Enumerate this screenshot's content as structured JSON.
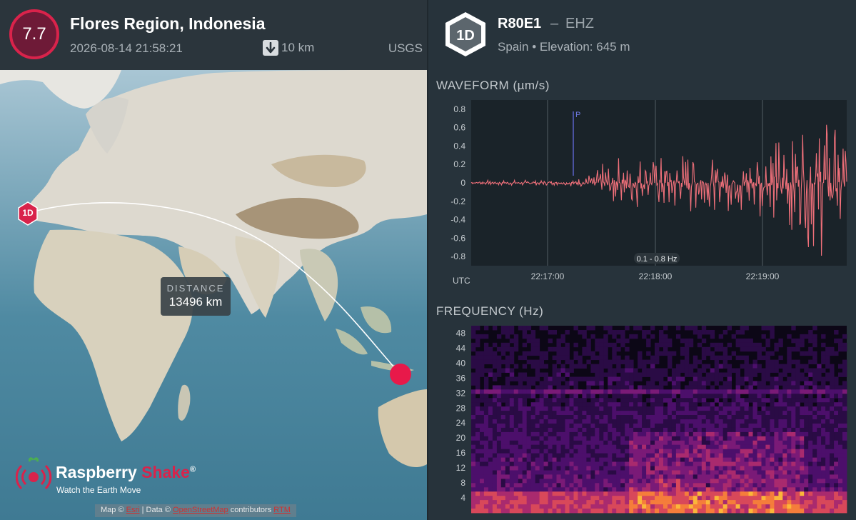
{
  "event": {
    "magnitude": "7.7",
    "title": "Flores Region, Indonesia",
    "datetime": "2026-08-14 21:58:21",
    "depth": "10 km",
    "source": "USGS"
  },
  "map": {
    "station_marker_label": "1D",
    "distance_label": "DISTANCE",
    "distance_value": "13496 km",
    "brand_name_part1": "Raspberry",
    "brand_name_part2": "Shake",
    "brand_registered": "®",
    "brand_tagline": "Watch the Earth Move",
    "attribution_prefix": "Map ©",
    "attribution_link1": "Esri",
    "attribution_mid": "| Data ©",
    "attribution_link2": "OpenStreetMap",
    "attribution_suffix": "contributors",
    "attribution_link3": "RTM",
    "colors": {
      "epicenter": "#e8194a",
      "station": "#d9234b",
      "path": "#ffffff"
    }
  },
  "station": {
    "badge": "1D",
    "code": "R80E1",
    "separator": "–",
    "channel": "EHZ",
    "location": "Spain • Elevation: 645 m"
  },
  "waveform": {
    "title": "WAVEFORM  (µm/s)",
    "y_ticks": [
      "0.8",
      "0.6",
      "0.4",
      "0.2",
      "0",
      "-0.2",
      "-0.4",
      "-0.6",
      "-0.8"
    ],
    "x_ticks": [
      "22:17:00",
      "22:18:00",
      "22:19:00"
    ],
    "x_axis_label": "UTC",
    "filter_label": "0.1 - 0.8 Hz",
    "phase_marker": "P",
    "line_color": "#f0707a"
  },
  "frequency": {
    "title": "FREQUENCY  (Hz)",
    "y_ticks": [
      "48",
      "44",
      "40",
      "36",
      "32",
      "28",
      "24",
      "20",
      "16",
      "12",
      "8",
      "4"
    ]
  },
  "chart_data": [
    {
      "type": "line",
      "title": "WAVEFORM (µm/s)",
      "xlabel": "UTC",
      "ylabel": "µm/s",
      "ylim": [
        -0.9,
        0.9
      ],
      "x_ticks": [
        "22:17:00",
        "22:18:00",
        "22:19:00"
      ],
      "series": [
        {
          "name": "EHZ",
          "description_points_time_offsets_s": [
            0,
            40,
            60,
            80,
            100,
            120,
            140,
            160,
            180,
            190,
            200,
            210
          ],
          "values": [
            0.0,
            0.0,
            0.05,
            0.3,
            -0.3,
            0.35,
            -0.3,
            0.45,
            -0.6,
            0.85,
            -0.8,
            0.6
          ]
        }
      ],
      "annotations": [
        "P",
        "0.1 - 0.8 Hz"
      ]
    },
    {
      "type": "heatmap",
      "title": "FREQUENCY (Hz)",
      "ylabel": "Hz",
      "ylim": [
        0,
        50
      ],
      "y_ticks": [
        4,
        8,
        12,
        16,
        20,
        24,
        28,
        32,
        36,
        40,
        44,
        48
      ]
    }
  ]
}
